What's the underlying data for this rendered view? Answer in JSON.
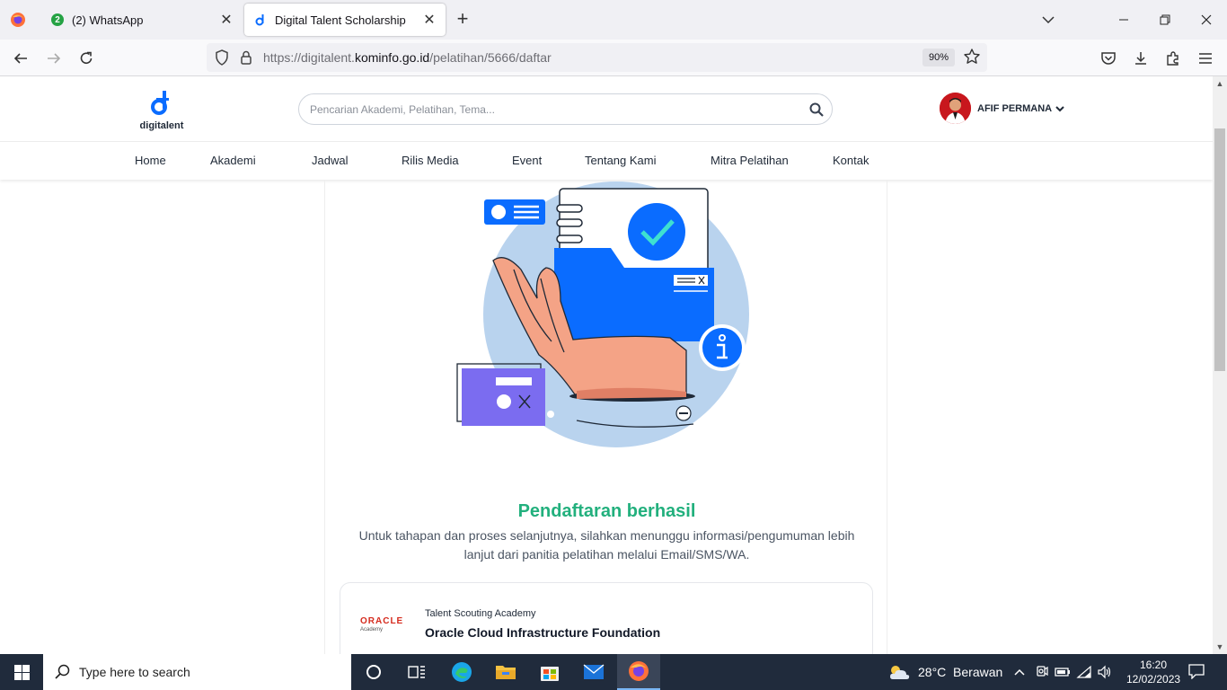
{
  "browser": {
    "tabs": [
      {
        "label": "(2) WhatsApp",
        "badge": "2",
        "active": false
      },
      {
        "label": "Digital Talent Scholarship",
        "active": true
      }
    ],
    "url_prefix": "https://digitalent.",
    "url_domain": "kominfo.go.id",
    "url_path": "/pelatihan/5666/daftar",
    "zoom": "90%"
  },
  "site": {
    "logo_text": "digitalent",
    "search_placeholder": "Pencarian Akademi, Pelatihan, Tema...",
    "user_name": "AFIF PERMANA",
    "menu": [
      "Home",
      "Akademi",
      "Jadwal",
      "Rilis Media",
      "Event",
      "Tentang Kami",
      "Mitra Pelatihan",
      "Kontak"
    ]
  },
  "main": {
    "success_title": "Pendaftaran berhasil",
    "success_message": "Untuk tahapan dan proses selanjutnya, silahkan menunggu informasi/pengumuman lebih lanjut dari panitia pelatihan melalui Email/SMS/WA.",
    "course": {
      "logo_text": "ORACLE",
      "logo_sub": "Academy",
      "academy": "Talent Scouting Academy",
      "name": "Oracle Cloud Infrastructure Foundation"
    }
  },
  "taskbar": {
    "search_placeholder": "Type here to search",
    "weather": "28°C  Berawan",
    "time": "16:20",
    "date": "12/02/2023"
  },
  "colors": {
    "brand_blue": "#0a6cff",
    "success_green": "#22b07d",
    "taskbar_bg": "#202b3c"
  }
}
